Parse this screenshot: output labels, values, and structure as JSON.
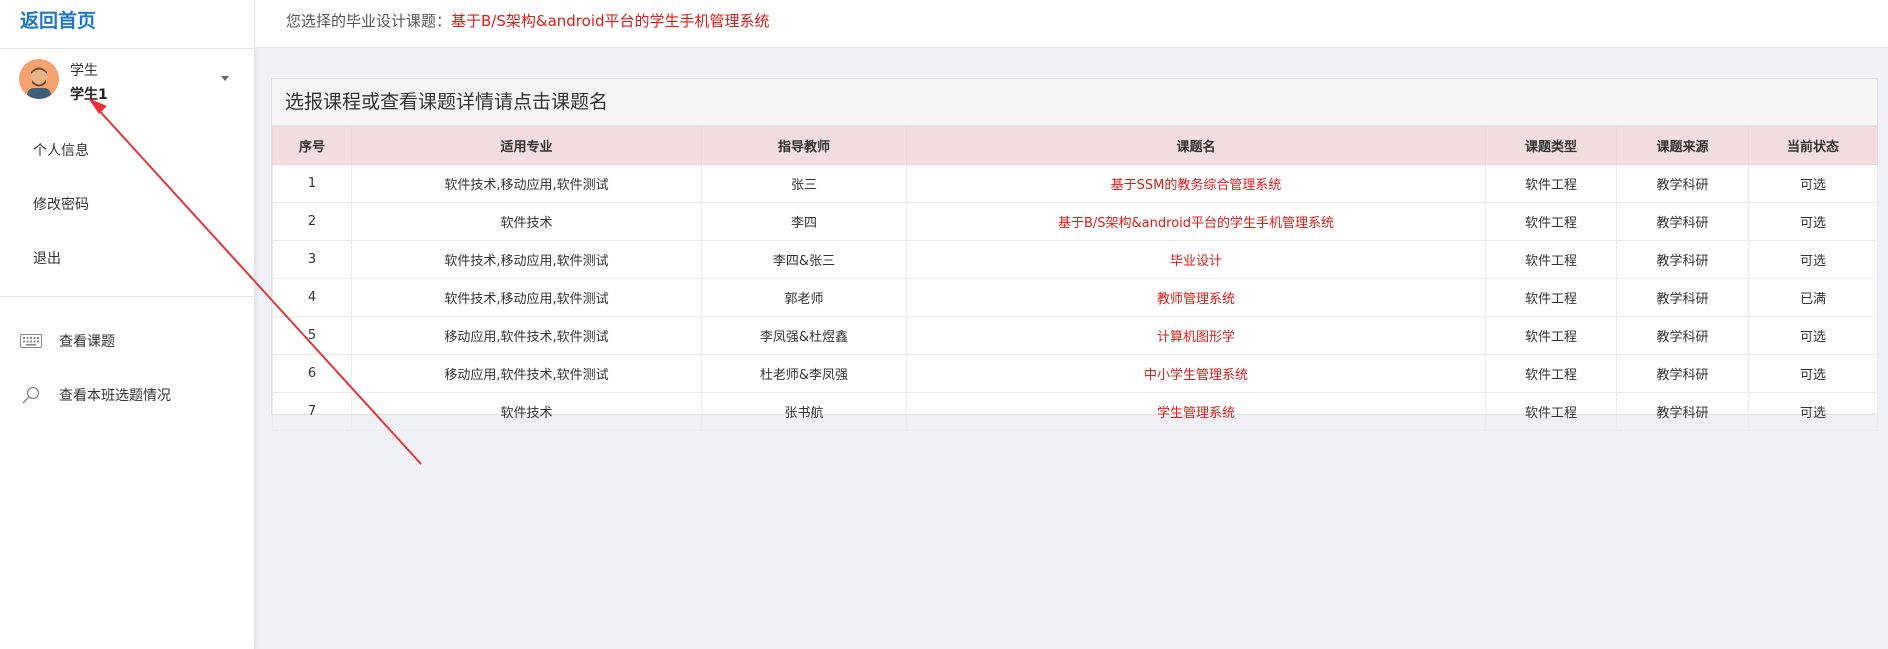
{
  "sidebar": {
    "home_link": "返回首页",
    "user": {
      "role": "学生",
      "name": "学生1"
    },
    "menu": [
      {
        "label": "个人信息"
      },
      {
        "label": "修改密码"
      },
      {
        "label": "退出"
      }
    ],
    "nav": [
      {
        "label": "查看课题",
        "icon": "keyboard-icon"
      },
      {
        "label": "查看本班选题情况",
        "icon": "search-icon"
      }
    ]
  },
  "topbar": {
    "label": "您选择的毕业设计课题：",
    "value": "基于B/S架构&android平台的学生手机管理系统"
  },
  "panel": {
    "title": "选报课程或查看课题详情请点击课题名",
    "columns": [
      "序号",
      "适用专业",
      "指导教师",
      "课题名",
      "课题类型",
      "课题来源",
      "当前状态"
    ],
    "rows": [
      [
        "1",
        "软件技术,移动应用,软件测试",
        "张三",
        "基于SSM的教务综合管理系统",
        "软件工程",
        "教学科研",
        "可选"
      ],
      [
        "2",
        "软件技术",
        "李四",
        "基于B/S架构&android平台的学生手机管理系统",
        "软件工程",
        "教学科研",
        "可选"
      ],
      [
        "3",
        "软件技术,移动应用,软件测试",
        "李四&张三",
        "毕业设计",
        "软件工程",
        "教学科研",
        "可选"
      ],
      [
        "4",
        "软件技术,移动应用,软件测试",
        "郭老师",
        "教师管理系统",
        "软件工程",
        "教学科研",
        "已满"
      ],
      [
        "5",
        "移动应用,软件技术,软件测试",
        "李凤强&杜煜鑫",
        "计算机图形学",
        "软件工程",
        "教学科研",
        "可选"
      ],
      [
        "6",
        "移动应用,软件技术,软件测试",
        "杜老师&李凤强",
        "中小学生管理系统",
        "软件工程",
        "教学科研",
        "可选"
      ],
      [
        "7",
        "软件技术",
        "张书航",
        "学生管理系统",
        "软件工程",
        "教学科研",
        "可选"
      ]
    ]
  },
  "colors": {
    "accent": "#1e76c8",
    "link_red": "#e41b17",
    "header_bg": "#f2dede",
    "annotation_arrow": "#e8333a"
  }
}
